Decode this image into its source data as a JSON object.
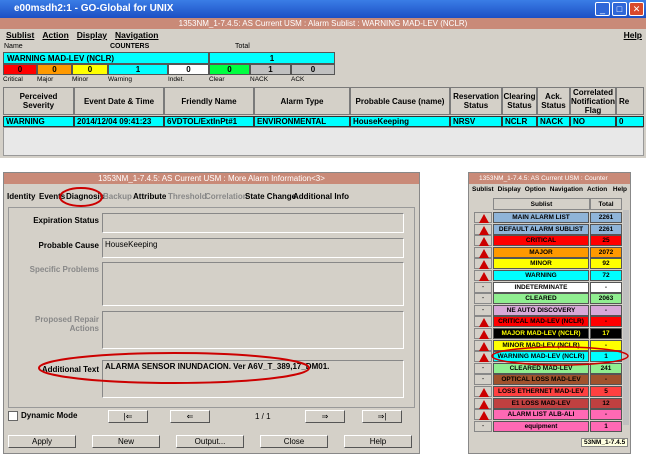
{
  "xp_window": {
    "title": "e00msdh2:1 - GO-Global for UNIX",
    "minimize": "_",
    "maximize": "□",
    "close": "✕"
  },
  "main_window": {
    "title": "1353NM_1-7.4.5: AS Current USM : Alarm Sublist : WARNING MAD-LEV (NCLR)",
    "menu": [
      "Sublist",
      "Action",
      "Display",
      "Navigation"
    ],
    "help": "Help",
    "counters_header": {
      "name": "Name",
      "counters": "COUNTERS",
      "total": "Total"
    },
    "sublist_name": "WARNING MAD-LEV (NCLR)",
    "sublist_total": "1",
    "counter_values": [
      "0",
      "0",
      "0",
      "1",
      "0",
      "0",
      "1",
      "0"
    ],
    "counter_labels": [
      "Critical",
      "Major",
      "Minor",
      "Warning",
      "Indet.",
      "Clear",
      "NACK",
      "ACK"
    ],
    "columns": [
      "Perceived Severity",
      "Event Date & Time",
      "Friendly Name",
      "Alarm Type",
      "Probable Cause (name)",
      "Reservation Status",
      "Clearing Status",
      "Ack. Status",
      "Correlated Notification Flag",
      "Re"
    ],
    "row": [
      "WARNING",
      "2014/12/04 09:41:23",
      "6VDTOL/ExtInPt#1",
      "ENVIRONMENTAL",
      "HouseKeeping",
      "NRSV",
      "NCLR",
      "NACK",
      "NO",
      "0"
    ]
  },
  "detail_window": {
    "title": "1353NM_1-7.4.5: AS Current USM : More Alarm Information<3>",
    "tabs": [
      "Identity",
      "Events",
      "Diagnosis",
      "Backup",
      "Attribute",
      "Threshold",
      "Correlation",
      "State Change",
      "Additional Info"
    ],
    "fields": {
      "expiration_status": {
        "label": "Expiration Status",
        "value": ""
      },
      "probable_cause": {
        "label": "Probable Cause",
        "value": "HouseKeeping"
      },
      "specific_problems": {
        "label": "Specific Problems",
        "value": ""
      },
      "proposed_repair": {
        "label": "Proposed Repair Actions",
        "value": ""
      },
      "additional_text": {
        "label": "Additional Text",
        "value": "ALARMA SENSOR INUNDACION. Ver A6V_T_389,17_DM01."
      }
    },
    "dynamic_mode": "Dynamic Mode",
    "page_indicator": "1 / 1",
    "nav": [
      "|⇐",
      "⇐",
      "⇒",
      "⇒|"
    ],
    "buttons": [
      "Apply",
      "New",
      "Output...",
      "Close",
      "Help"
    ]
  },
  "counter_window": {
    "title": "1353NM_1-7.4.5: AS Current USM : Counter",
    "menu": [
      "Sublist",
      "Display",
      "Option",
      "Navigation",
      "Action"
    ],
    "help": "Help",
    "col_sublist": "Sublist",
    "col_total": "Total",
    "rows": [
      {
        "name": "MAIN ALARM LIST",
        "total": "2261",
        "color": "#8fb4d8",
        "icon": "warn"
      },
      {
        "name": "DEFAULT ALARM SUBLIST",
        "total": "2261",
        "color": "#8fb4d8",
        "icon": "warn"
      },
      {
        "name": "CRITICAL",
        "total": "25",
        "color": "#ff0000",
        "icon": "warn"
      },
      {
        "name": "MAJOR",
        "total": "2072",
        "color": "#ff9900",
        "icon": "warn"
      },
      {
        "name": "MINOR",
        "total": "92",
        "color": "#ffff00",
        "icon": "warn"
      },
      {
        "name": "WARNING",
        "total": "72",
        "color": "#00ffff",
        "icon": "warn"
      },
      {
        "name": "INDETERMINATE",
        "total": "-",
        "color": "#ffffff",
        "icon": "none"
      },
      {
        "name": "CLEARED",
        "total": "2063",
        "color": "#90ee90",
        "icon": "none"
      },
      {
        "name": "NE AUTO DISCOVERY",
        "total": "-",
        "color": "#d8a8d8",
        "icon": "none"
      },
      {
        "name": "CRITICAL MAD-LEV (NCLR)",
        "total": "-",
        "color": "#ff0000",
        "icon": "warn"
      },
      {
        "name": "MAJOR MAD-LEV (NCLR)",
        "total": "17",
        "color": "#000000",
        "icon": "warn"
      },
      {
        "name": "MINOR MAD-LEV (NCLR)",
        "total": "-",
        "color": "#ffff00",
        "icon": "warn"
      },
      {
        "name": "WARNING MAD-LEV (NCLR)",
        "total": "1",
        "color": "#00ffff",
        "icon": "warn"
      },
      {
        "name": "CLEARED MAD-LEV",
        "total": "241",
        "color": "#90ee90",
        "icon": "none"
      },
      {
        "name": "OPTICAL LOSS MAD-LEV",
        "total": "-",
        "color": "#a0522d",
        "icon": "none"
      },
      {
        "name": "LOSS ETHERNET MAD-LEV",
        "total": "5",
        "color": "#ff4040",
        "icon": "warn"
      },
      {
        "name": "E1 LOSS MAD-LEV",
        "total": "12",
        "color": "#c04040",
        "icon": "warn"
      },
      {
        "name": "ALARM LIST ALB-ALI",
        "total": "-",
        "color": "#ff69b4",
        "icon": "warn"
      },
      {
        "name": "equipment",
        "total": "1",
        "color": "#ff69b4",
        "icon": "none"
      }
    ],
    "status": "53NM_1-7.4.5"
  }
}
